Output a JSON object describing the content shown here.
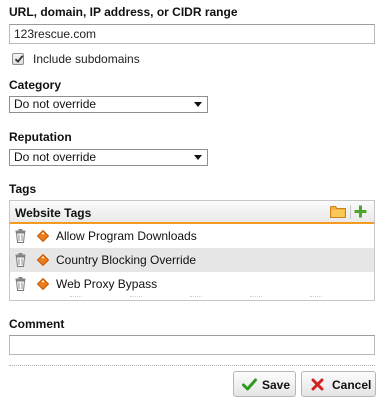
{
  "destination": {
    "label": "URL, domain, IP address, or CIDR range",
    "value": "123rescue.com",
    "include_subdomains": {
      "label": "Include subdomains",
      "checked": true
    }
  },
  "category": {
    "label": "Category",
    "selected": "Do not override"
  },
  "reputation": {
    "label": "Reputation",
    "selected": "Do not override"
  },
  "tags": {
    "label": "Tags",
    "panel_title": "Website Tags",
    "icons": {
      "browse": "folder-icon",
      "add": "plus-icon",
      "delete": "trash-icon",
      "tag": "tag-icon"
    },
    "accent_color": "#f39a1f",
    "items": [
      {
        "label": "Allow Program Downloads"
      },
      {
        "label": "Country Blocking Override"
      },
      {
        "label": "Web Proxy Bypass"
      }
    ]
  },
  "comment": {
    "label": "Comment",
    "value": ""
  },
  "buttons": {
    "save": "Save",
    "cancel": "Cancel"
  }
}
